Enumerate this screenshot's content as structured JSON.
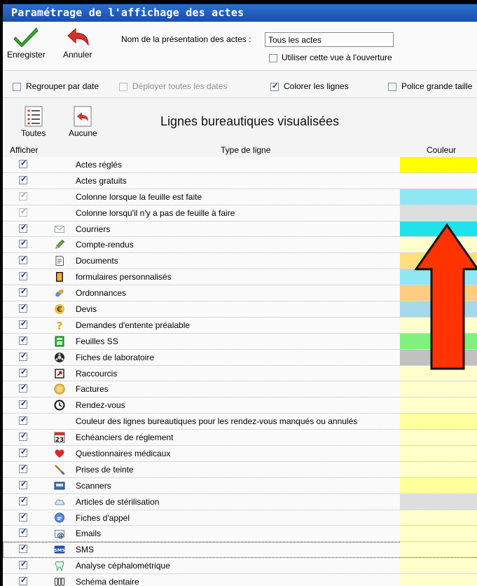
{
  "window": {
    "title": "Paramétrage de l'affichage des actes"
  },
  "toolbar": {
    "save_label": "Enregister",
    "cancel_label": "Annuler",
    "name_label": "Nom de la présentation des actes :",
    "name_value": "Tous les actes",
    "open_view_label": "Utiliser cette vue à l'ouverture",
    "open_view_checked": false
  },
  "options": [
    {
      "label": "Regrouper par date",
      "checked": false,
      "enabled": true
    },
    {
      "label": "Déployer toutes les dates",
      "checked": false,
      "enabled": false
    },
    {
      "label": "Colorer les lignes",
      "checked": true,
      "enabled": true
    },
    {
      "label": "Police grande taille",
      "checked": false,
      "enabled": true
    }
  ],
  "selection": {
    "all_label": "Toutes",
    "none_label": "Aucune",
    "title": "Lignes bureautiques visualisées"
  },
  "table": {
    "headers": {
      "show": "Afficher",
      "type": "Type de ligne",
      "color": "Couleur"
    },
    "rows": [
      {
        "label": "Actes réglés",
        "icon": "none",
        "color": "#ffff00",
        "checked": true,
        "dim": false
      },
      {
        "label": "Actes gratuits",
        "icon": "none",
        "color": "#fafafa",
        "checked": true,
        "dim": false
      },
      {
        "label": "Colonne lorsque la feuille est faite",
        "icon": "none",
        "color": "#8ee8f4",
        "checked": true,
        "dim": true
      },
      {
        "label": "Colonne lorsqu'il n'y a pas de feuille à faire",
        "icon": "none",
        "color": "#dedede",
        "checked": true,
        "dim": true
      },
      {
        "label": "Courriers",
        "icon": "envelope-icon",
        "color": "#1fe3ea",
        "checked": true,
        "dim": false
      },
      {
        "label": "Compte-rendus",
        "icon": "pencil-icon",
        "color": "#ffffcc",
        "checked": true,
        "dim": false
      },
      {
        "label": "Documents",
        "icon": "document-icon",
        "color": "#ffe07a",
        "checked": true,
        "dim": false
      },
      {
        "label": "formulaires personnalisés",
        "icon": "form-icon",
        "color": "#8ee8f4",
        "checked": true,
        "dim": false
      },
      {
        "label": "Ordonnances",
        "icon": "pill-icon",
        "color": "#ffcc80",
        "checked": true,
        "dim": false
      },
      {
        "label": "Devis",
        "icon": "euro-icon",
        "color": "#a6d8ea",
        "checked": true,
        "dim": false
      },
      {
        "label": "Demandes d'entente préalable",
        "icon": "question-icon",
        "color": "#ffffcc",
        "checked": true,
        "dim": false
      },
      {
        "label": "Feuilles SS",
        "icon": "sheet-icon",
        "color": "#80f080",
        "checked": true,
        "dim": false
      },
      {
        "label": "Fiches de laboratoire",
        "icon": "lab-icon",
        "color": "#c0c0c0",
        "checked": true,
        "dim": false
      },
      {
        "label": "Raccourcis",
        "icon": "shortcut-icon",
        "color": "#ffffcc",
        "checked": true,
        "dim": false
      },
      {
        "label": "Factures",
        "icon": "invoice-icon",
        "color": "#ffffcc",
        "checked": true,
        "dim": false
      },
      {
        "label": "Rendez-vous",
        "icon": "clock-icon",
        "color": "#ffffcc",
        "checked": true,
        "dim": false
      },
      {
        "label": "Couleur des lignes bureautiques pour les rendez-vous manqués ou annulés",
        "icon": "none",
        "color": "#ffffa0",
        "checked": true,
        "dim": false
      },
      {
        "label": "Echéanciers de réglement",
        "icon": "calendar-icon",
        "color": "#ffffcc",
        "checked": true,
        "dim": false
      },
      {
        "label": "Questionnaires médicaux",
        "icon": "heart-icon",
        "color": "#ffffcc",
        "checked": true,
        "dim": false
      },
      {
        "label": "Prises de teinte",
        "icon": "brush-icon",
        "color": "#ffffcc",
        "checked": true,
        "dim": false
      },
      {
        "label": "Scanners",
        "icon": "scanner-icon",
        "color": "#ffff99",
        "checked": true,
        "dim": false
      },
      {
        "label": "Articles de stérilisation",
        "icon": "cloud-icon",
        "color": "#dedede",
        "checked": true,
        "dim": false
      },
      {
        "label": "Fiches d'appel",
        "icon": "chat-icon",
        "color": "#ffffcc",
        "checked": true,
        "dim": false
      },
      {
        "label": "Emails",
        "icon": "email-icon",
        "color": "#ffffcc",
        "checked": true,
        "dim": false
      },
      {
        "label": "SMS",
        "icon": "sms-icon",
        "color": "#ffffcc",
        "checked": true,
        "dim": false
      },
      {
        "label": "Analyse céphalométrique",
        "icon": "tooth-icon",
        "color": "#ffffcc",
        "checked": true,
        "dim": false
      },
      {
        "label": "Schéma dentaire",
        "icon": "teeth-icon",
        "color": "#ffffcc",
        "checked": true,
        "dim": false
      }
    ]
  },
  "overlay": {
    "arrow_color": "#ff3300",
    "arrow_outline": "#111111"
  },
  "icons_text": {
    "calendar_day": "23",
    "sms_text": "SMS",
    "euro_symbol": "€",
    "question_symbol": "?",
    "at_symbol": "@"
  }
}
